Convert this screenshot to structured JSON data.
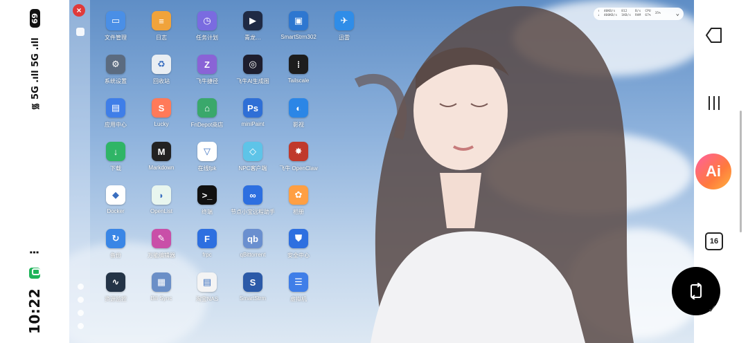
{
  "status": {
    "time": "10:22",
    "more": "⋮",
    "signal": "᯾ 5G .ıll 5G .ıll",
    "battery": "69"
  },
  "desktop": {
    "close": "×",
    "apps": [
      {
        "label": "文件管理",
        "color": "#4a8fe6",
        "glyph": "▭",
        "icon": "folder-icon"
      },
      {
        "label": "日志",
        "color": "#f0a33b",
        "glyph": "≡",
        "icon": "log-icon"
      },
      {
        "label": "任务计划",
        "color": "#7a6be0",
        "glyph": "◷",
        "icon": "clock-icon"
      },
      {
        "label": "青龙…",
        "color": "#1f2a44",
        "glyph": "▶",
        "icon": "play-icon"
      },
      {
        "label": "SmartStrm302",
        "color": "#2e77d0",
        "glyph": "▣",
        "icon": "smartstrm302-icon"
      },
      {
        "label": "迅雷",
        "color": "#2f8de8",
        "glyph": "✈",
        "icon": "thunder-bird-icon"
      },
      {
        "label": "系统设置",
        "color": "#5b6b80",
        "glyph": "⚙",
        "icon": "settings-icon"
      },
      {
        "label": "回收站",
        "color": "#e9eef3",
        "glyph": "♻",
        "icon": "recycle-bin-icon"
      },
      {
        "label": "飞牛捷径",
        "color": "#8a63d6",
        "glyph": "Z",
        "icon": "shortcut-icon"
      },
      {
        "label": "飞牛AI生成图",
        "color": "#1e1e2e",
        "glyph": "◎",
        "icon": "ai-image-icon"
      },
      {
        "label": "Tailscale",
        "color": "#1d1d1d",
        "glyph": "⁞",
        "icon": "tailscale-icon"
      },
      {
        "label": "",
        "color": "transparent",
        "glyph": "",
        "icon": "empty-slot"
      },
      {
        "label": "应用中心",
        "color": "#3f7ee8",
        "glyph": "▤",
        "icon": "app-store-icon"
      },
      {
        "label": "Lucky",
        "color": "#ff7a59",
        "glyph": "S",
        "icon": "lucky-icon"
      },
      {
        "label": "FnDepot商店",
        "color": "#3aa86b",
        "glyph": "⌂",
        "icon": "fndepot-icon"
      },
      {
        "label": "miniPaint",
        "color": "#2f6fd6",
        "glyph": "Ps",
        "icon": "minipaint-icon"
      },
      {
        "label": "影视",
        "color": "#2b86e6",
        "glyph": "◐",
        "icon": "video-icon"
      },
      {
        "label": "",
        "color": "transparent",
        "glyph": "",
        "icon": "empty-slot"
      },
      {
        "label": "下载",
        "color": "#2fb566",
        "glyph": "↓",
        "icon": "download-icon"
      },
      {
        "label": "Markdown",
        "color": "#222222",
        "glyph": "M",
        "icon": "markdown-icon"
      },
      {
        "label": "在线fpk",
        "color": "#ffffff",
        "glyph": "▽",
        "icon": "fpk-icon"
      },
      {
        "label": "NPC客户端",
        "color": "#5ec4e8",
        "glyph": "◇",
        "icon": "npc-client-icon"
      },
      {
        "label": "飞牛 OpenClaw",
        "color": "#c0392b",
        "glyph": "✸",
        "icon": "openclaw-icon"
      },
      {
        "label": "",
        "color": "transparent",
        "glyph": "",
        "icon": "empty-slot"
      },
      {
        "label": "Docker",
        "color": "#ffffff",
        "glyph": "◆",
        "icon": "docker-icon"
      },
      {
        "label": "OpenList",
        "color": "#e8f6ef",
        "glyph": "◗",
        "icon": "openlist-icon"
      },
      {
        "label": "终端",
        "color": "#111111",
        "glyph": ">_",
        "icon": "terminal-icon"
      },
      {
        "label": "节点小宝远程助手",
        "color": "#2d6fe0",
        "glyph": "∞",
        "icon": "remote-assistant-icon"
      },
      {
        "label": "相册",
        "color": "#ff9f43",
        "glyph": "✿",
        "icon": "photos-icon"
      },
      {
        "label": "",
        "color": "transparent",
        "glyph": "",
        "icon": "empty-slot"
      },
      {
        "label": "备份",
        "color": "#3a86e6",
        "glyph": "↻",
        "icon": "backup-icon"
      },
      {
        "label": "万能编辑器",
        "color": "#c94fa8",
        "glyph": "✎",
        "icon": "editor-icon"
      },
      {
        "label": "frpc",
        "color": "#2d6fe0",
        "glyph": "F",
        "icon": "frpc-icon"
      },
      {
        "label": "qBittorrent",
        "color": "#6a8fcf",
        "glyph": "qb",
        "icon": "qbittorrent-icon"
      },
      {
        "label": "安全中心",
        "color": "#2d6fe0",
        "glyph": "⛊",
        "icon": "security-center-icon"
      },
      {
        "label": "",
        "color": "transparent",
        "glyph": "",
        "icon": "empty-slot"
      },
      {
        "label": "资源监控",
        "color": "#243447",
        "glyph": "∿",
        "icon": "monitor-icon"
      },
      {
        "label": "Bili Sync",
        "color": "#6b8fc7",
        "glyph": "▦",
        "icon": "bili-sync-icon"
      },
      {
        "label": "淘宝NAS",
        "color": "#f4f4f4",
        "glyph": "▤",
        "icon": "taobao-nas-icon"
      },
      {
        "label": "SmartStrm",
        "color": "#2b5aa8",
        "glyph": "S",
        "icon": "smartstrm-icon"
      },
      {
        "label": "虚拟机",
        "color": "#3f7ee8",
        "glyph": "☰",
        "icon": "vm-icon"
      }
    ],
    "widget": {
      "up_label": "↑",
      "down_label": "↓",
      "up_speed": "40KB/s",
      "down_speed": "400KB/s",
      "disk_read_label": "B/s",
      "disk_read": "812",
      "disk_write": "1KB/s",
      "cpu_label": "CPU",
      "cpu_value": "35%",
      "ram_label": "RAM",
      "ram_value": "67%",
      "chevron": "⌄"
    }
  },
  "nav": {
    "ai_label": "Ai",
    "calendar": "16"
  }
}
